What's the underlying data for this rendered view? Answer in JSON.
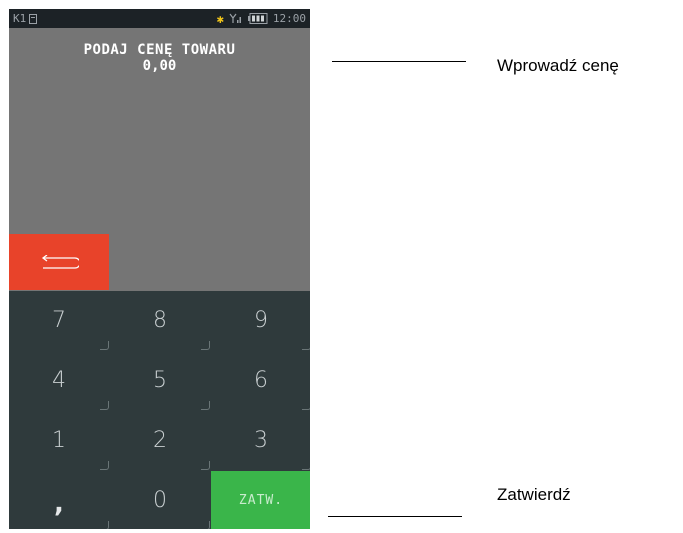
{
  "status_bar": {
    "register_label": "K1",
    "time": "12:00",
    "icons": [
      "printer-icon",
      "bluetooth-icon",
      "signal-icon",
      "battery-icon"
    ],
    "bluetooth_color": "#f0c419"
  },
  "screen": {
    "prompt": "PODAJ CENĘ TOWARU",
    "price_value": "0,00",
    "back_icon": "back-arrow-icon"
  },
  "keypad": {
    "row1": [
      "7",
      "8",
      "9"
    ],
    "row2": [
      "4",
      "5",
      "6"
    ],
    "row3": [
      "1",
      "2",
      "3"
    ],
    "row4": [
      ",",
      "0",
      "ZATW."
    ]
  },
  "callouts": {
    "price_entry": "Wprowadź cenę",
    "confirm": "Zatwierdź"
  },
  "colors": {
    "screen_bg": "#757575",
    "back_button": "#e8432a",
    "confirm_button": "#3ab54a",
    "keypad_bg": "#2f3a3c"
  }
}
